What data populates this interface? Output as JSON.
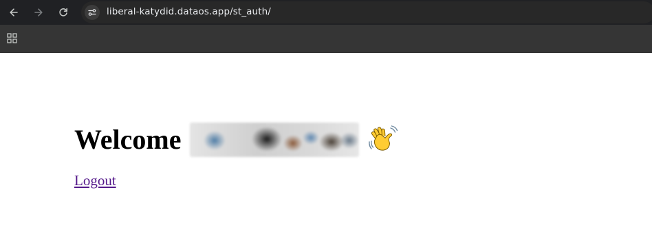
{
  "browser": {
    "url": "liberal-katydid.dataos.app/st_auth/"
  },
  "page": {
    "welcome_label": "Welcome",
    "logout_label": "Logout"
  },
  "colors": {
    "chrome_dark": "#202124",
    "bookmark_bar": "#353535",
    "visited_link": "#551a8b"
  },
  "icons": [
    "back-icon",
    "forward-icon",
    "reload-icon",
    "site-settings-icon",
    "apps-grid-icon",
    "waving-hand-icon"
  ]
}
